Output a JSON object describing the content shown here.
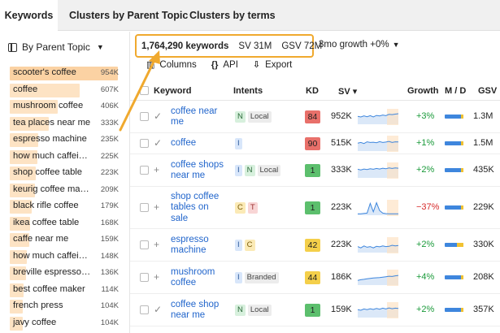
{
  "tabs": [
    {
      "label": "Keywords",
      "active": true
    },
    {
      "label": "Clusters by Parent Topic",
      "active": false
    },
    {
      "label": "Clusters by terms",
      "active": false
    }
  ],
  "sidebar": {
    "header": "By Parent Topic",
    "items": [
      {
        "name": "scooter's coffee",
        "value": "954K",
        "active": true,
        "share": 0.99
      },
      {
        "name": "coffee",
        "value": "607K",
        "active": false,
        "share": 0.64
      },
      {
        "name": "mushroom coffee",
        "value": "406K",
        "active": false,
        "share": 0.44
      },
      {
        "name": "tea places near me",
        "value": "333K",
        "active": false,
        "share": 0.36
      },
      {
        "name": "espresso machine",
        "value": "235K",
        "active": false,
        "share": 0.26
      },
      {
        "name": "how much caffei…",
        "value": "225K",
        "active": false,
        "share": 0.25
      },
      {
        "name": "shop coffee table",
        "value": "223K",
        "active": false,
        "share": 0.24
      },
      {
        "name": "keurig coffee ma…",
        "value": "209K",
        "active": false,
        "share": 0.23
      },
      {
        "name": "black rifle coffee",
        "value": "179K",
        "active": false,
        "share": 0.2
      },
      {
        "name": "ikea coffee table",
        "value": "168K",
        "active": false,
        "share": 0.19
      },
      {
        "name": "caffe near me",
        "value": "159K",
        "active": false,
        "share": 0.18
      },
      {
        "name": "how much caffei…",
        "value": "148K",
        "active": false,
        "share": 0.16
      },
      {
        "name": "breville espresso…",
        "value": "136K",
        "active": false,
        "share": 0.15
      },
      {
        "name": "best coffee maker",
        "value": "114K",
        "active": false,
        "share": 0.13
      },
      {
        "name": "french press",
        "value": "104K",
        "active": false,
        "share": 0.12
      },
      {
        "name": "javy coffee",
        "value": "104K",
        "active": false,
        "share": 0.12
      }
    ]
  },
  "summary": {
    "keywords": "1,764,290 keywords",
    "sv": "SV 31M",
    "gsv": "GSV 72M"
  },
  "growth_filter": "3mo growth +0%",
  "actions": {
    "columns": "Columns",
    "api": "API",
    "export": "Export"
  },
  "table": {
    "headers": {
      "keyword": "Keyword",
      "intents": "Intents",
      "kd": "KD",
      "sv": "SV ▾",
      "growth": "Growth",
      "md": "M / D",
      "gsv": "GSV"
    },
    "rows": [
      {
        "keyword": "coffee near me",
        "mark": "check",
        "intents": [
          "N"
        ],
        "labels": [
          "Local"
        ],
        "kd": "84",
        "kd_color": "#e8706a",
        "sv": "952K",
        "growth": "+3%",
        "growth_dir": "pos",
        "md_desktop_share": 0.12,
        "gsv": "1.3M",
        "trend": [
          0.55,
          0.5,
          0.58,
          0.52,
          0.6,
          0.5,
          0.62,
          0.58,
          0.65,
          0.6,
          0.7,
          0.68,
          0.72,
          0.75
        ]
      },
      {
        "keyword": "coffee",
        "mark": "check",
        "intents": [
          "I"
        ],
        "labels": [],
        "kd": "90",
        "kd_color": "#e8706a",
        "sv": "515K",
        "growth": "+1%",
        "growth_dir": "pos",
        "md_desktop_share": 0.12,
        "gsv": "1.5M",
        "trend": [
          0.55,
          0.6,
          0.52,
          0.65,
          0.6,
          0.62,
          0.58,
          0.66,
          0.6,
          0.63,
          0.68,
          0.6,
          0.65,
          0.64
        ]
      },
      {
        "keyword": "coffee shops near me",
        "mark": "plus",
        "intents": [
          "I",
          "N"
        ],
        "labels": [
          "Local"
        ],
        "kd": "1",
        "kd_color": "#5cbf6d",
        "sv": "333K",
        "growth": "+2%",
        "growth_dir": "pos",
        "md_desktop_share": 0.12,
        "gsv": "435K",
        "trend": [
          0.6,
          0.55,
          0.62,
          0.58,
          0.64,
          0.6,
          0.66,
          0.62,
          0.68,
          0.64,
          0.7,
          0.66,
          0.7,
          0.68
        ]
      },
      {
        "keyword": "shop coffee tables on sale",
        "mark": "plus",
        "intents": [
          "C",
          "T"
        ],
        "labels": [],
        "kd": "1",
        "kd_color": "#5cbf6d",
        "sv": "223K",
        "growth": "−37%",
        "growth_dir": "neg",
        "md_desktop_share": 0.12,
        "gsv": "229K",
        "trend": [
          0.05,
          0.05,
          0.08,
          0.1,
          0.85,
          0.2,
          0.9,
          0.3,
          0.1,
          0.06,
          0.05,
          0.05,
          0.05,
          0.05
        ]
      },
      {
        "keyword": "espresso machine",
        "mark": "plus",
        "intents": [
          "I",
          "C"
        ],
        "labels": [],
        "kd": "42",
        "kd_color": "#f4cf4a",
        "sv": "223K",
        "growth": "+2%",
        "growth_dir": "pos",
        "md_desktop_share": 0.35,
        "gsv": "330K",
        "trend": [
          0.4,
          0.3,
          0.45,
          0.35,
          0.4,
          0.3,
          0.42,
          0.38,
          0.45,
          0.4,
          0.42,
          0.5,
          0.45,
          0.48
        ]
      },
      {
        "keyword": "mushroom coffee",
        "mark": "plus",
        "intents": [
          "I"
        ],
        "labels": [
          "Branded"
        ],
        "kd": "44",
        "kd_color": "#f4cf4a",
        "sv": "186K",
        "growth": "+4%",
        "growth_dir": "pos",
        "md_desktop_share": 0.12,
        "gsv": "208K",
        "trend": [
          0.3,
          0.35,
          0.38,
          0.42,
          0.45,
          0.48,
          0.5,
          0.52,
          0.55,
          0.58,
          0.62,
          0.6,
          0.65,
          0.68
        ]
      },
      {
        "keyword": "coffee shop near me",
        "mark": "check",
        "intents": [
          "N"
        ],
        "labels": [
          "Local"
        ],
        "kd": "1",
        "kd_color": "#5cbf6d",
        "sv": "159K",
        "growth": "+2%",
        "growth_dir": "pos",
        "md_desktop_share": 0.12,
        "gsv": "357K",
        "trend": [
          0.55,
          0.5,
          0.6,
          0.55,
          0.62,
          0.56,
          0.64,
          0.58,
          0.66,
          0.6,
          0.68,
          0.62,
          0.66,
          0.64
        ]
      }
    ]
  },
  "colors": {
    "highlight_border": "#f0a92e",
    "bar_fill": "#fde3c4",
    "link": "#2266cc",
    "positive": "#1a9a3a",
    "negative": "#d62a2a"
  }
}
